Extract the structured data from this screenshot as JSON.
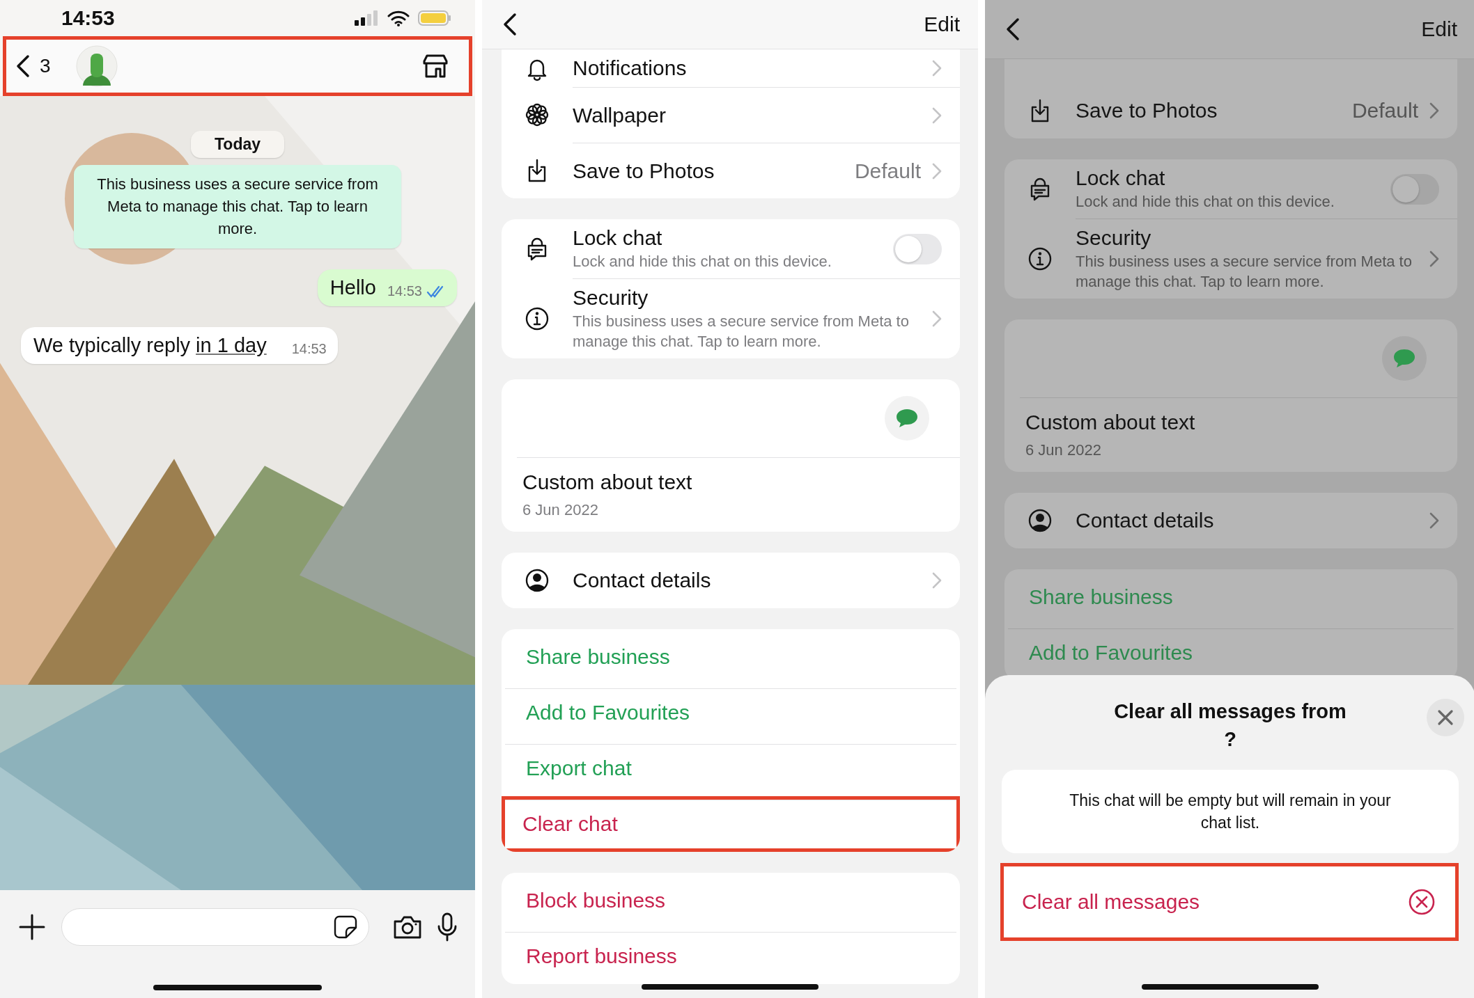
{
  "chat_screen": {
    "status_bar": {
      "time": "14:53"
    },
    "header": {
      "back_count": "3",
      "highlighted": true
    },
    "date_chip": "Today",
    "system_notice": "This business uses a secure service from Meta to manage this chat. Tap to learn more.",
    "messages": [
      {
        "kind": "outgoing",
        "text": "Hello",
        "time": "14:53",
        "read": true
      },
      {
        "kind": "incoming",
        "text": "We typically reply",
        "link": "in 1 day",
        "time": "14:53"
      }
    ]
  },
  "info_screen": {
    "edit": "Edit",
    "dimmed": false,
    "groups": [
      {
        "items": [
          {
            "kind": "notifications",
            "label": "Notifications"
          },
          {
            "kind": "wallpaper",
            "label": "Wallpaper"
          },
          {
            "kind": "save",
            "label": "Save to Photos",
            "value": "Default"
          }
        ]
      },
      {
        "items": [
          {
            "kind": "lock",
            "label": "Lock chat",
            "detail": "Lock and hide this chat on this device.",
            "on": false
          },
          {
            "kind": "security",
            "label": "Security",
            "detail": "This business uses a secure service from Meta to manage this chat. Tap to learn more."
          }
        ]
      },
      {
        "items": [
          {
            "kind": "about",
            "label": "Custom about text",
            "date": "6 Jun 2022"
          }
        ]
      },
      {
        "items": [
          {
            "kind": "contact",
            "label": "Contact details"
          }
        ]
      },
      {
        "items": [
          {
            "kind": "action",
            "label": "Share business",
            "destructive": false,
            "highlighted": false
          },
          {
            "kind": "action",
            "label": "Add to Favourites",
            "destructive": false,
            "highlighted": false
          },
          {
            "kind": "action",
            "label": "Export chat",
            "destructive": false,
            "highlighted": false
          },
          {
            "kind": "action",
            "label": "Clear chat",
            "destructive": true,
            "highlighted": true
          }
        ]
      },
      {
        "items": [
          {
            "kind": "action",
            "label": "Block business",
            "destructive": true,
            "highlighted": false
          },
          {
            "kind": "action",
            "label": "Report business",
            "destructive": true,
            "highlighted": false
          }
        ]
      }
    ]
  },
  "clear_screen": {
    "edit": "Edit",
    "dimmed": true,
    "groups": [
      {
        "items": [
          {
            "kind": "save",
            "label": "Save to Photos",
            "value": "Default"
          }
        ]
      },
      {
        "items": [
          {
            "kind": "lock",
            "label": "Lock chat",
            "detail": "Lock and hide this chat on this device.",
            "on": false
          },
          {
            "kind": "security",
            "label": "Security",
            "detail": "This business uses a secure service from Meta to manage this chat. Tap to learn more."
          }
        ]
      },
      {
        "items": [
          {
            "kind": "about",
            "label": "Custom about text",
            "date": "6 Jun 2022"
          }
        ]
      },
      {
        "items": [
          {
            "kind": "contact",
            "label": "Contact details"
          }
        ]
      },
      {
        "items": [
          {
            "kind": "action",
            "label": "Share business",
            "destructive": false,
            "highlighted": false
          },
          {
            "kind": "action",
            "label": "Add to Favourites",
            "destructive": false,
            "highlighted": false
          }
        ]
      }
    ],
    "sheet": {
      "title": "Clear all messages from",
      "title_end": "?",
      "message": "This chat will be empty but will remain in your chat list.",
      "action": "Clear all messages",
      "action_highlighted": true
    }
  }
}
